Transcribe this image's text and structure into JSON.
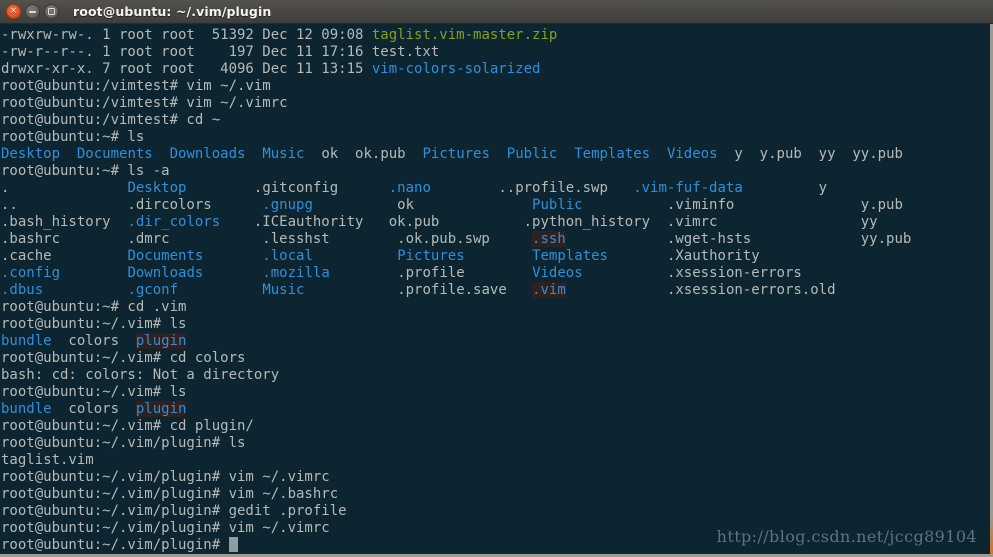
{
  "window": {
    "title": "root@ubuntu: ~/.vim/plugin",
    "close_label": "×",
    "minimize_label": "",
    "maximize_label": ""
  },
  "colors": {
    "terminal_background": "#0d2530",
    "default_text": "#b5bab6",
    "directory": "#2f8fd9",
    "archive": "#84a01f",
    "highlight_background": "#30201e",
    "titlebar": "#4a4843",
    "close_button": "#e0582b",
    "cursor": "#8f9d9c",
    "watermark": "#5d7480"
  },
  "watermark": "http://blog.csdn.net/jccg89104",
  "terminal": {
    "rows": [
      [
        {
          "t": "-rwxrw-rw-. 1 root root  51392 Dec 12 09:08 ",
          "s": "def"
        },
        {
          "t": "taglist.vim-master.zip",
          "s": "arch"
        }
      ],
      [
        {
          "t": "-rw-r--r--. 1 root root    197 Dec 11 17:16 test.txt",
          "s": "def"
        }
      ],
      [
        {
          "t": "drwxr-xr-x. 7 root root   4096 Dec 11 13:15 ",
          "s": "def"
        },
        {
          "t": "vim-colors-solarized",
          "s": "dir"
        }
      ],
      [
        {
          "t": "root@ubuntu:/vimtest# vim ~/.vim",
          "s": "def"
        }
      ],
      [
        {
          "t": "root@ubuntu:/vimtest# vim ~/.vimrc",
          "s": "def"
        }
      ],
      [
        {
          "t": "root@ubuntu:/vimtest# cd ~",
          "s": "def"
        }
      ],
      [
        {
          "t": "root@ubuntu:~# ls",
          "s": "def"
        }
      ],
      [
        {
          "t": "Desktop",
          "s": "dir"
        },
        {
          "t": "  ",
          "s": "def"
        },
        {
          "t": "Documents",
          "s": "dir"
        },
        {
          "t": "  ",
          "s": "def"
        },
        {
          "t": "Downloads",
          "s": "dir"
        },
        {
          "t": "  ",
          "s": "def"
        },
        {
          "t": "Music",
          "s": "dir"
        },
        {
          "t": "  ",
          "s": "def"
        },
        {
          "t": "ok  ok.pub  ",
          "s": "def"
        },
        {
          "t": "Pictures",
          "s": "dir"
        },
        {
          "t": "  ",
          "s": "def"
        },
        {
          "t": "Public",
          "s": "dir"
        },
        {
          "t": "  ",
          "s": "def"
        },
        {
          "t": "Templates",
          "s": "dir"
        },
        {
          "t": "  ",
          "s": "def"
        },
        {
          "t": "Videos",
          "s": "dir"
        },
        {
          "t": "  ",
          "s": "def"
        },
        {
          "t": "y  y.pub  yy  yy.pub",
          "s": "def"
        }
      ],
      [
        {
          "t": "root@ubuntu:~# ls -a",
          "s": "def"
        }
      ],
      [
        {
          "t": ".              ",
          "s": "def"
        },
        {
          "t": "Desktop",
          "s": "dir"
        },
        {
          "t": "        ",
          "s": "def"
        },
        {
          "t": ".gitconfig      ",
          "s": "def"
        },
        {
          "t": ".nano",
          "s": "dir"
        },
        {
          "t": "        ",
          "s": "def"
        },
        {
          "t": "..profile.swp   ",
          "s": "def"
        },
        {
          "t": ".vim-fuf-data",
          "s": "dir"
        },
        {
          "t": "         ",
          "s": "def"
        },
        {
          "t": "y",
          "s": "def"
        }
      ],
      [
        {
          "t": "..             .dircolors      ",
          "s": "def"
        },
        {
          "t": ".gnupg",
          "s": "dir"
        },
        {
          "t": "          ",
          "s": "def"
        },
        {
          "t": "ok              ",
          "s": "def"
        },
        {
          "t": "Public",
          "s": "dir"
        },
        {
          "t": "          ",
          "s": "def"
        },
        {
          "t": ".viminfo               y.pub",
          "s": "def"
        }
      ],
      [
        {
          "t": ".bash_history  ",
          "s": "def"
        },
        {
          "t": ".dir_colors",
          "s": "dir"
        },
        {
          "t": "    ",
          "s": "def"
        },
        {
          "t": ".ICEauthority   ok.pub          .python_history  .vimrc                 yy",
          "s": "def"
        }
      ],
      [
        {
          "t": ".bashrc        .dmrc           .lesshst        .ok.pub.swp     ",
          "s": "def"
        },
        {
          "t": ".ssh",
          "s": "hl"
        },
        {
          "t": "            ",
          "s": "def"
        },
        {
          "t": ".wget-hsts             yy.pub",
          "s": "def"
        }
      ],
      [
        {
          "t": ".cache         ",
          "s": "def"
        },
        {
          "t": "Documents",
          "s": "dir"
        },
        {
          "t": "       ",
          "s": "def"
        },
        {
          "t": ".local",
          "s": "dir"
        },
        {
          "t": "          ",
          "s": "def"
        },
        {
          "t": "Pictures",
          "s": "dir"
        },
        {
          "t": "        ",
          "s": "def"
        },
        {
          "t": "Templates",
          "s": "dir"
        },
        {
          "t": "       ",
          "s": "def"
        },
        {
          "t": ".Xauthority",
          "s": "def"
        }
      ],
      [
        {
          "t": ".config",
          "s": "dir"
        },
        {
          "t": "        ",
          "s": "def"
        },
        {
          "t": "Downloads",
          "s": "dir"
        },
        {
          "t": "       ",
          "s": "def"
        },
        {
          "t": ".mozilla",
          "s": "dir"
        },
        {
          "t": "        ",
          "s": "def"
        },
        {
          "t": ".profile        ",
          "s": "def"
        },
        {
          "t": "Videos",
          "s": "dir"
        },
        {
          "t": "          ",
          "s": "def"
        },
        {
          "t": ".xsession-errors",
          "s": "def"
        }
      ],
      [
        {
          "t": ".dbus",
          "s": "dir"
        },
        {
          "t": "          ",
          "s": "def"
        },
        {
          "t": ".gconf",
          "s": "dir"
        },
        {
          "t": "          ",
          "s": "def"
        },
        {
          "t": "Music",
          "s": "dir"
        },
        {
          "t": "           ",
          "s": "def"
        },
        {
          "t": ".profile.save   ",
          "s": "def"
        },
        {
          "t": ".vim",
          "s": "hl"
        },
        {
          "t": "            ",
          "s": "def"
        },
        {
          "t": ".xsession-errors.old",
          "s": "def"
        }
      ],
      [
        {
          "t": "root@ubuntu:~# cd .vim",
          "s": "def"
        }
      ],
      [
        {
          "t": "root@ubuntu:~/.vim# ls",
          "s": "def"
        }
      ],
      [
        {
          "t": "bundle",
          "s": "dir"
        },
        {
          "t": "  colors  ",
          "s": "def"
        },
        {
          "t": "plugin",
          "s": "hl"
        }
      ],
      [
        {
          "t": "root@ubuntu:~/.vim# cd colors",
          "s": "def"
        }
      ],
      [
        {
          "t": "bash: cd: colors: Not a directory",
          "s": "def"
        }
      ],
      [
        {
          "t": "root@ubuntu:~/.vim# ls",
          "s": "def"
        }
      ],
      [
        {
          "t": "bundle",
          "s": "dir"
        },
        {
          "t": "  colors  ",
          "s": "def"
        },
        {
          "t": "plugin",
          "s": "hl"
        }
      ],
      [
        {
          "t": "root@ubuntu:~/.vim# cd plugin/",
          "s": "def"
        }
      ],
      [
        {
          "t": "root@ubuntu:~/.vim/plugin# ls",
          "s": "def"
        }
      ],
      [
        {
          "t": "taglist.vim",
          "s": "def"
        }
      ],
      [
        {
          "t": "root@ubuntu:~/.vim/plugin# vim ~/.vimrc",
          "s": "def"
        }
      ],
      [
        {
          "t": "root@ubuntu:~/.vim/plugin# vim ~/.bashrc",
          "s": "def"
        }
      ],
      [
        {
          "t": "root@ubuntu:~/.vim/plugin# gedit .profile",
          "s": "def"
        }
      ],
      [
        {
          "t": "root@ubuntu:~/.vim/plugin# vim ~/.vimrc",
          "s": "def"
        }
      ],
      [
        {
          "t": "root@ubuntu:~/.vim/plugin# ",
          "s": "def",
          "cursor": true
        }
      ]
    ]
  }
}
